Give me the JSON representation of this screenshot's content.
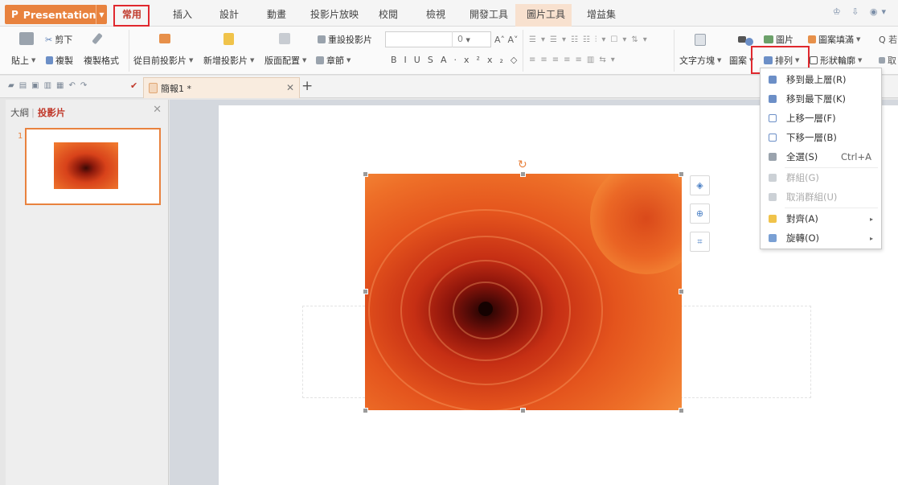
{
  "app": {
    "name": "Presentation"
  },
  "menu": [
    "常用",
    "插入",
    "設計",
    "動畫",
    "投影片放映",
    "校閱",
    "檢視",
    "開發工具",
    "圖片工具",
    "增益集"
  ],
  "ribbon": {
    "paste": "貼上",
    "cut": "剪下",
    "copy": "複製",
    "format_painter": "複製格式",
    "from_current": "從目前投影片",
    "new_slide": "新增投影片",
    "layout": "版面配置",
    "section": "章節",
    "reset_slide": "重設投影片",
    "font_size": "0",
    "text_box": "文字方塊",
    "shape": "圖案",
    "picture": "圖片",
    "shape_fill": "圖案填滿",
    "arrange": "排列",
    "shape_outline": "形狀輪廓",
    "find_clip": "Q 若",
    "replace_clip": "取"
  },
  "doc_tab": {
    "title": "簡報1 *"
  },
  "left_panel": {
    "tab_outline": "大綱",
    "tab_slides": "投影片",
    "slide_number": "1"
  },
  "arrange_menu": [
    {
      "label": "移到最上層(R)",
      "shortcut": "",
      "enabled": true,
      "submenu": false
    },
    {
      "label": "移到最下層(K)",
      "shortcut": "",
      "enabled": true,
      "submenu": false
    },
    {
      "label": "上移一層(F)",
      "shortcut": "",
      "enabled": true,
      "submenu": false
    },
    {
      "label": "下移一層(B)",
      "shortcut": "",
      "enabled": true,
      "submenu": false
    },
    {
      "label": "全選(S)",
      "shortcut": "Ctrl+A",
      "enabled": true,
      "submenu": false
    },
    {
      "label": "群組(G)",
      "shortcut": "",
      "enabled": false,
      "submenu": false
    },
    {
      "label": "取消群組(U)",
      "shortcut": "",
      "enabled": false,
      "submenu": false
    },
    {
      "label": "對齊(A)",
      "shortcut": "",
      "enabled": true,
      "submenu": true
    },
    {
      "label": "旋轉(O)",
      "shortcut": "",
      "enabled": true,
      "submenu": true
    }
  ],
  "colors": {
    "accent": "#e8823e",
    "highlight_box": "#e0282e",
    "active_tab_text": "#c0392b"
  }
}
